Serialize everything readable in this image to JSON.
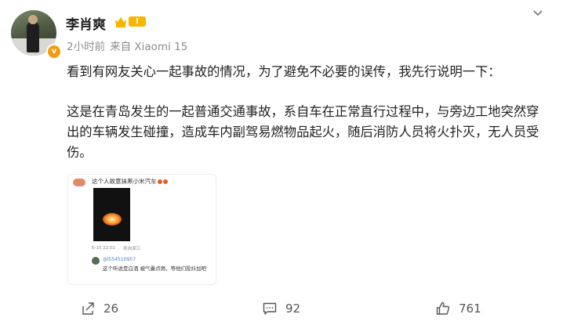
{
  "post": {
    "author": "李肖爽",
    "level": "I",
    "time": "2小时前",
    "source": "来自 Xiaomi 15",
    "paragraph1": "看到有网友关心一起事故的情况，为了避免不必要的误传，我先行说明一下：",
    "paragraph2": "这是在青岛发生的一起普通交通事故，系自车在正常直行过程中，与旁边工地突然穿出的车辆发生碰撞，造成车内副驾易燃物品起火，随后消防人员将火扑灭，无人员受伤。"
  },
  "embed": {
    "title": "这个人故意抹黑小米汽车",
    "meta_date": "6-10 22:02",
    "meta_loc": "发自浙江",
    "commenter": "@l554510957",
    "comment": "这个听说是白酒 被气囊点燃，等他们投抖加吧"
  },
  "footer": {
    "share_count": "26",
    "comment_count": "92",
    "like_count": "761"
  },
  "icons": [
    "verified-v-icon",
    "crown-icon",
    "chevron-down-icon",
    "share-icon",
    "comment-icon",
    "like-icon"
  ],
  "colors": {
    "level_badge": "#f7b500",
    "verified": "#f59a12",
    "meta_text": "#8d8d8d",
    "link_blue": "#4a7cc2"
  }
}
